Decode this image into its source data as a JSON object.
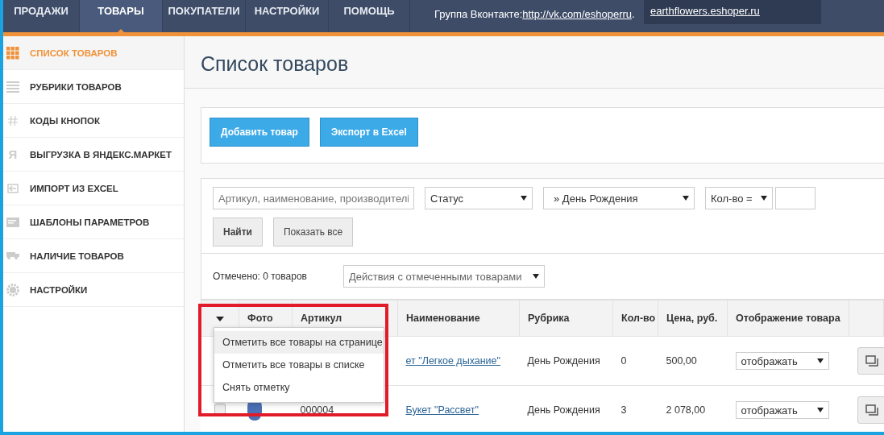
{
  "top_nav": {
    "items": [
      {
        "label": "ПРОДАЖИ",
        "selected": false
      },
      {
        "label": "ТОВАРЫ",
        "selected": true
      },
      {
        "label": "ПОКУПАТЕЛИ",
        "selected": false
      },
      {
        "label": "НАСТРОЙКИ",
        "selected": false
      },
      {
        "label": "ПОМОЩЬ",
        "selected": false
      }
    ],
    "info_label": "Группа Вконтакте:",
    "info_link": "http://vk.com/eshoperru",
    "info_end": ".",
    "site_link": "earthflowers.eshoper.ru"
  },
  "sidebar": {
    "items": [
      {
        "label": "СПИСОК ТОВАРОВ",
        "kind": "grid",
        "selected": true
      },
      {
        "label": "РУБРИКИ ТОВАРОВ",
        "kind": "lines",
        "selected": false
      },
      {
        "label": "КОДЫ КНОПОК",
        "kind": "hash",
        "selected": false
      },
      {
        "label": "ВЫГРУЗКА В ЯНДЕКС.МАРКЕТ",
        "kind": "glyph",
        "icon_char": "Я",
        "selected": false
      },
      {
        "label": "ИМПОРТ ИЗ EXCEL",
        "kind": "import",
        "selected": false
      },
      {
        "label": "ШАБЛОНЫ ПАРАМЕТРОВ",
        "kind": "template",
        "selected": false
      },
      {
        "label": "НАЛИЧИЕ ТОВАРОВ",
        "kind": "truck",
        "selected": false
      },
      {
        "label": "НАСТРОЙКИ",
        "kind": "gear",
        "selected": false
      }
    ]
  },
  "page_title": "Список товаров",
  "actions": [
    "Добавить товар",
    "Экспорт в Excel"
  ],
  "filters": {
    "search_placeholder": "Артикул, наименование, производителі",
    "status": "Статус",
    "category": "» День Рождения",
    "qty": "Кол-во =",
    "buttons": [
      "Найти",
      "Показать все"
    ]
  },
  "marked": "Отмечено: 0 товаров",
  "bulk_action": "Действия с отмеченными товарами",
  "table": {
    "columns": [
      "Фото",
      "Артикул",
      "Наименование",
      "Рубрика",
      "Кол-во",
      "Цена, руб.",
      "Отображение товара"
    ],
    "rows": [
      {
        "checked": null,
        "article": "",
        "name": "ет \"Легкое дыхание\"",
        "category": "День Рождения",
        "qty": "0",
        "price": "500,00",
        "display": "отображать"
      },
      {
        "checked": false,
        "article": "000004",
        "name": "Букет \"Рассвет\"",
        "category": "День Рождения",
        "qty": "3",
        "price": "2 078,00",
        "display": "отображать"
      }
    ]
  },
  "select_menu": {
    "items": [
      {
        "label": "Отметить все товары на странице",
        "selected": true
      },
      {
        "label": "Отметить все товары в списке",
        "selected": false
      },
      {
        "label": "Снять отметку",
        "selected": false
      }
    ]
  }
}
